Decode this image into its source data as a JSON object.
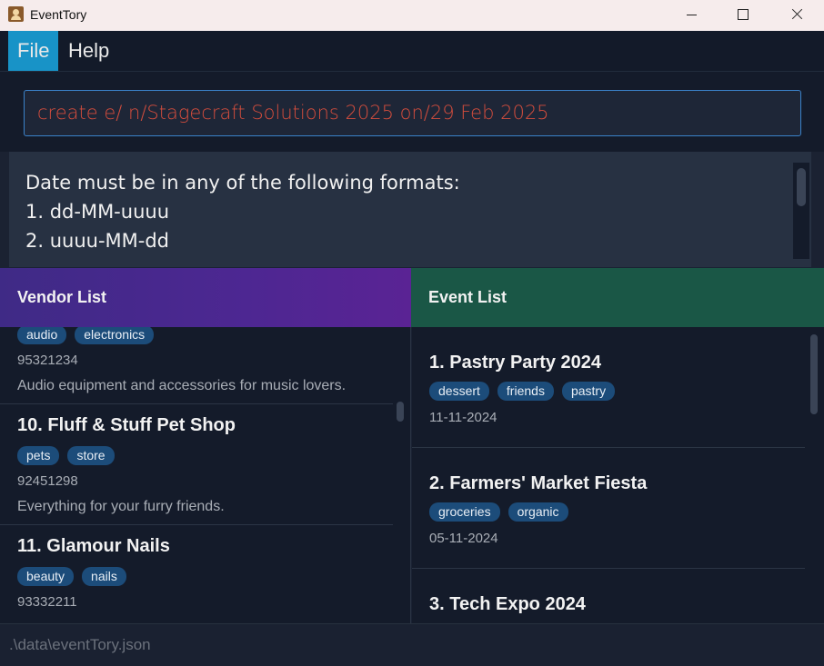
{
  "window": {
    "title": "EventTory"
  },
  "menu": {
    "file": "File",
    "help": "Help"
  },
  "command": {
    "value": "create e/ n/Stagecraft Solutions 2025 on/29 Feb 2025"
  },
  "result": {
    "lines": [
      "Date must be in any of the following formats:",
      "1. dd-MM-uuuu",
      "2. uuuu-MM-dd"
    ]
  },
  "vendor_list": {
    "header": "Vendor List",
    "items": [
      {
        "title": "",
        "tags": [
          "audio",
          "electronics"
        ],
        "phone": "95321234",
        "description": "Audio equipment and accessories for music lovers."
      },
      {
        "title": "10. Fluff & Stuff Pet Shop",
        "tags": [
          "pets",
          "store"
        ],
        "phone": "92451298",
        "description": "Everything for your furry friends."
      },
      {
        "title": "11. Glamour Nails",
        "tags": [
          "beauty",
          "nails"
        ],
        "phone": "93332211",
        "description": ""
      }
    ]
  },
  "event_list": {
    "header": "Event List",
    "items": [
      {
        "title": "1. Pastry Party 2024",
        "tags": [
          "dessert",
          "friends",
          "pastry"
        ],
        "date": "11-11-2024"
      },
      {
        "title": "2. Farmers' Market Fiesta",
        "tags": [
          "groceries",
          "organic"
        ],
        "date": "05-11-2024"
      },
      {
        "title": "3. Tech Expo 2024",
        "tags": [],
        "date": ""
      }
    ]
  },
  "status": {
    "path": ".\\data\\eventTory.json"
  },
  "colors": {
    "accent": "#1893c7",
    "command_error": "#d44d3d",
    "tag_bg": "#1c4c7a",
    "vendor_header": "#4d2792",
    "event_header": "#1a5746"
  }
}
